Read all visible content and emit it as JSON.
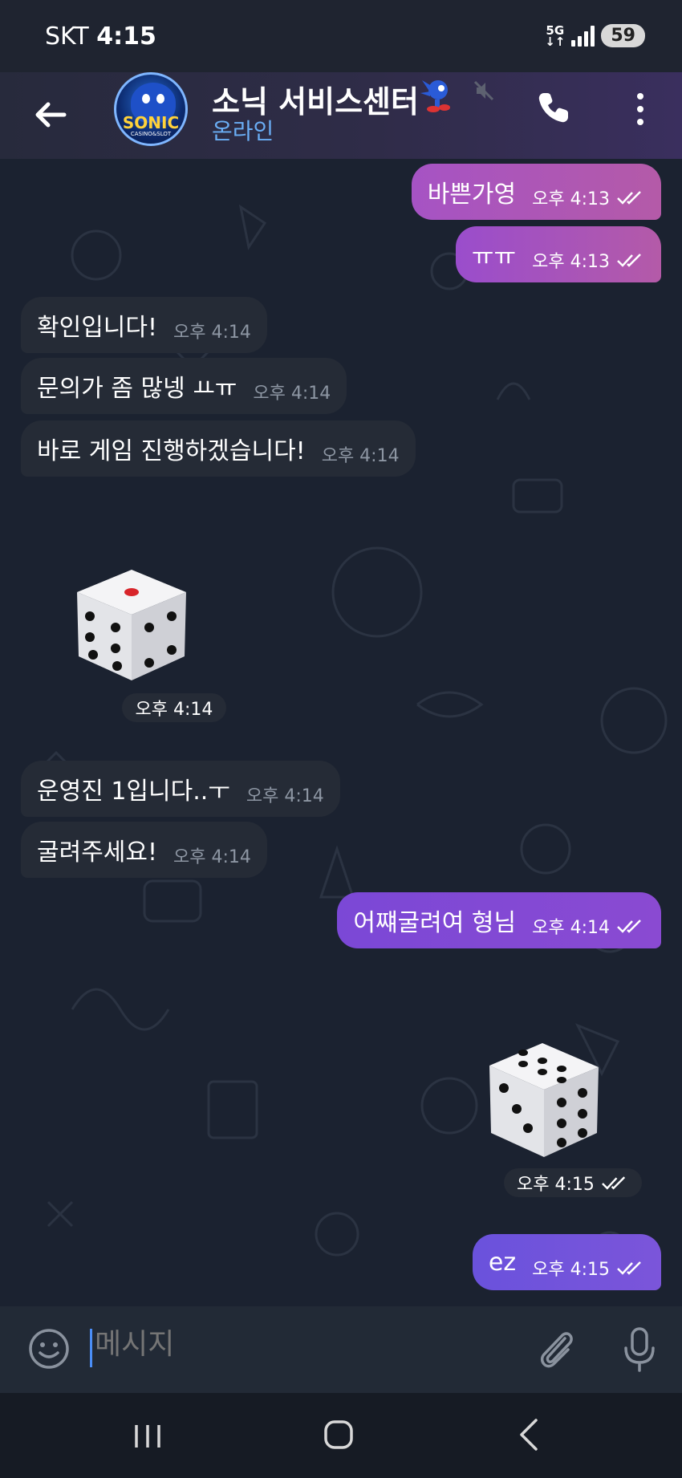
{
  "status_bar": {
    "carrier": "SKT",
    "time": "4:15",
    "network": "5G",
    "battery": "59"
  },
  "header": {
    "title": "소닉 서비스센터",
    "status": "온라인"
  },
  "avatar": {
    "logo_main": "SONIC",
    "logo_sub": "CASINO&SLOT"
  },
  "messages": [
    {
      "dir": "out",
      "text": "바쁜가영",
      "time": "오후 4:13"
    },
    {
      "dir": "out",
      "text": "ㅠㅠ",
      "time": "오후 4:13"
    },
    {
      "dir": "in",
      "text": "확인입니다!",
      "time": "오후 4:14"
    },
    {
      "dir": "in",
      "text": "문의가 좀 많넹 ㅛㅠ",
      "time": "오후 4:14"
    },
    {
      "dir": "in",
      "text": "바로 게임 진행하겠습니다!",
      "time": "오후 4:14"
    },
    {
      "dir": "in",
      "type": "dice",
      "value": 1,
      "time": "오후 4:14"
    },
    {
      "dir": "in",
      "text": "운영진 1입니다..ㅜ",
      "time": "오후 4:14"
    },
    {
      "dir": "in",
      "text": "굴려주세요!",
      "time": "오후 4:14"
    },
    {
      "dir": "out",
      "text": "어쨰굴려여 형님",
      "time": "오후 4:14"
    },
    {
      "dir": "out",
      "type": "dice",
      "value": 6,
      "time": "오후 4:15"
    },
    {
      "dir": "out",
      "text": "ez",
      "time": "오후 4:15"
    }
  ],
  "input": {
    "placeholder": "메시지"
  },
  "colors": {
    "outgoing_start": "#8b45d8",
    "outgoing_end": "#b159a8",
    "incoming": "#252b36",
    "accent": "#6aaef5"
  },
  "icons": [
    "back-arrow-icon",
    "mute-icon",
    "phone-icon",
    "more-vertical-icon",
    "emoji-icon",
    "paperclip-icon",
    "microphone-icon",
    "nav-recent-icon",
    "nav-home-icon",
    "nav-back-icon",
    "double-check-icon",
    "dice-icon"
  ]
}
